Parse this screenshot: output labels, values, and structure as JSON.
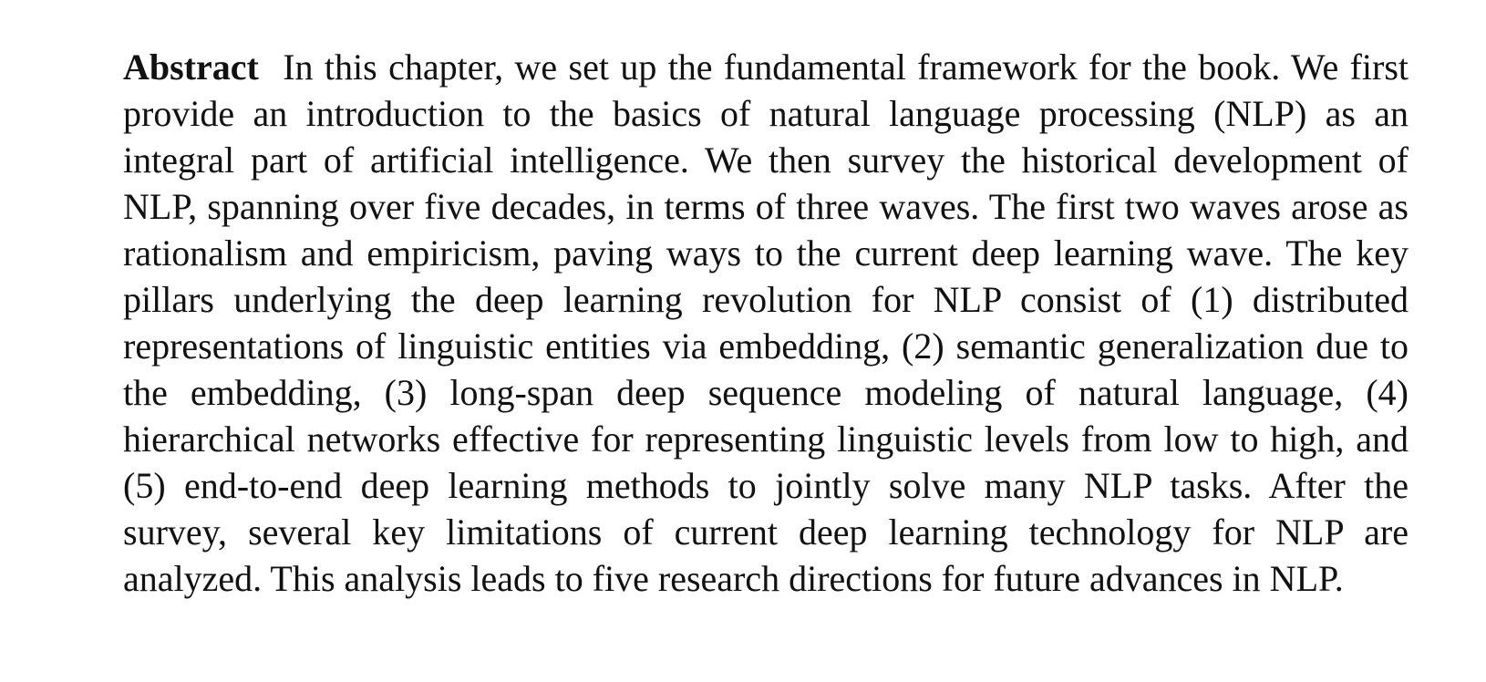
{
  "abstract": {
    "label": "Abstract",
    "text": "In this chapter, we set up the fundamental framework for the book. We first provide an introduction to the basics of natural language processing (NLP) as an integral part of artificial intelligence. We then survey the historical development of NLP, spanning over five decades, in terms of three waves. The first two waves arose as rationalism and empiricism, paving ways to the current deep learning wave. The key pillars underlying the deep learning revolution for NLP consist of (1) distributed representations of linguistic entities via embedding, (2) semantic generalization due to the embedding, (3) long-span deep sequence modeling of natural language, (4) hierarchical networks effective for representing linguistic levels from low to high, and (5) end-to-end deep learning methods to jointly solve many NLP tasks. After the survey, several key limitations of current deep learning technology for NLP are analyzed. This analysis leads to five research directions for future advances in NLP."
  }
}
